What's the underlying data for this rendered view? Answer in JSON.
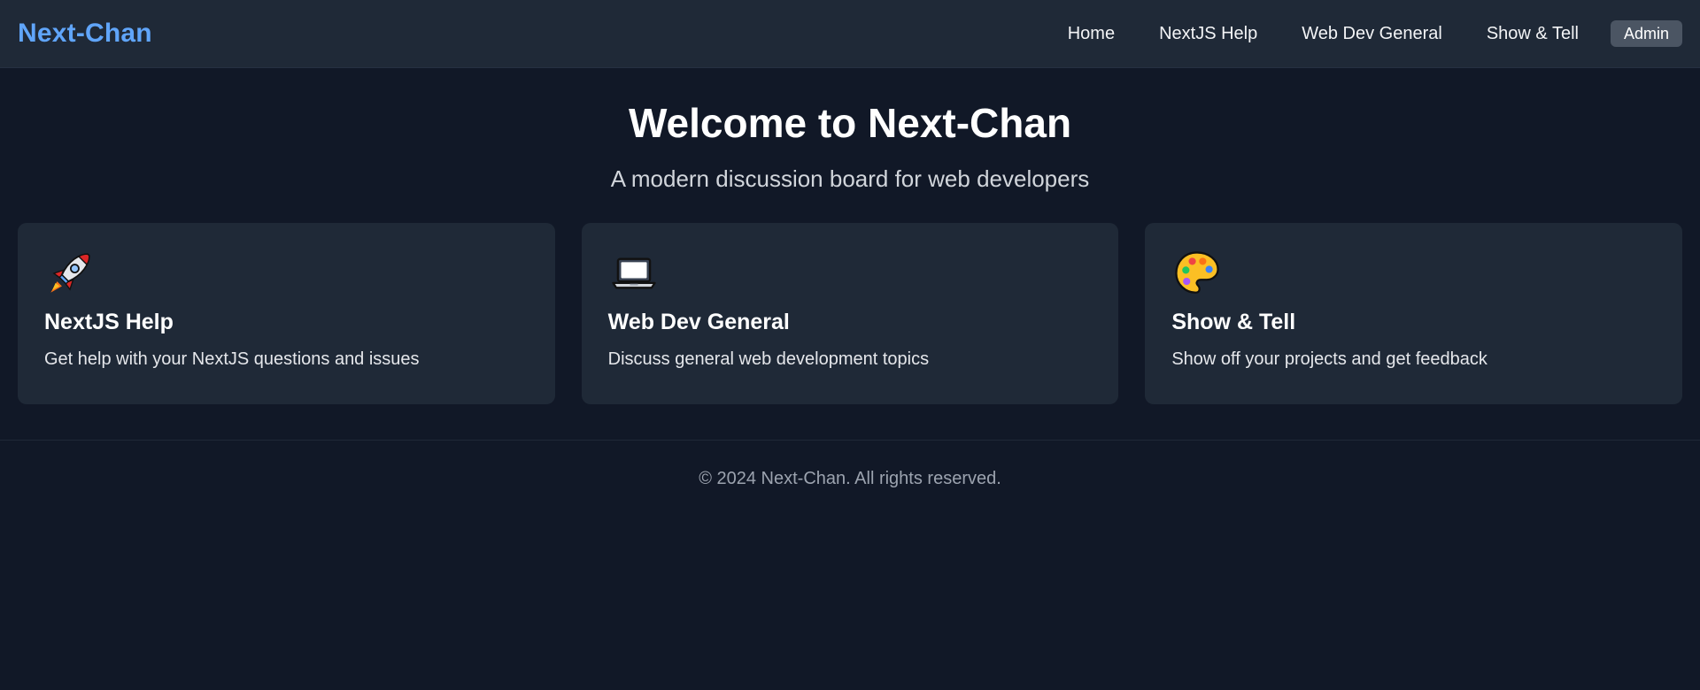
{
  "header": {
    "brand": "Next-Chan",
    "nav": [
      {
        "label": "Home"
      },
      {
        "label": "NextJS Help"
      },
      {
        "label": "Web Dev General"
      },
      {
        "label": "Show & Tell"
      }
    ],
    "admin_label": "Admin"
  },
  "hero": {
    "title": "Welcome to Next-Chan",
    "subtitle": "A modern discussion board for web developers"
  },
  "boards": [
    {
      "icon": "rocket-icon",
      "title": "NextJS Help",
      "description": "Get help with your NextJS questions and issues"
    },
    {
      "icon": "laptop-icon",
      "title": "Web Dev General",
      "description": "Discuss general web development topics"
    },
    {
      "icon": "palette-icon",
      "title": "Show & Tell",
      "description": "Show off your projects and get feedback"
    }
  ],
  "footer": {
    "text": "© 2024 Next-Chan. All rights reserved."
  },
  "colors": {
    "background": "#111827",
    "header_bg": "#1f2937",
    "card_bg": "#1f2937",
    "brand": "#60a5fa",
    "admin_button_bg": "#4b5563"
  }
}
